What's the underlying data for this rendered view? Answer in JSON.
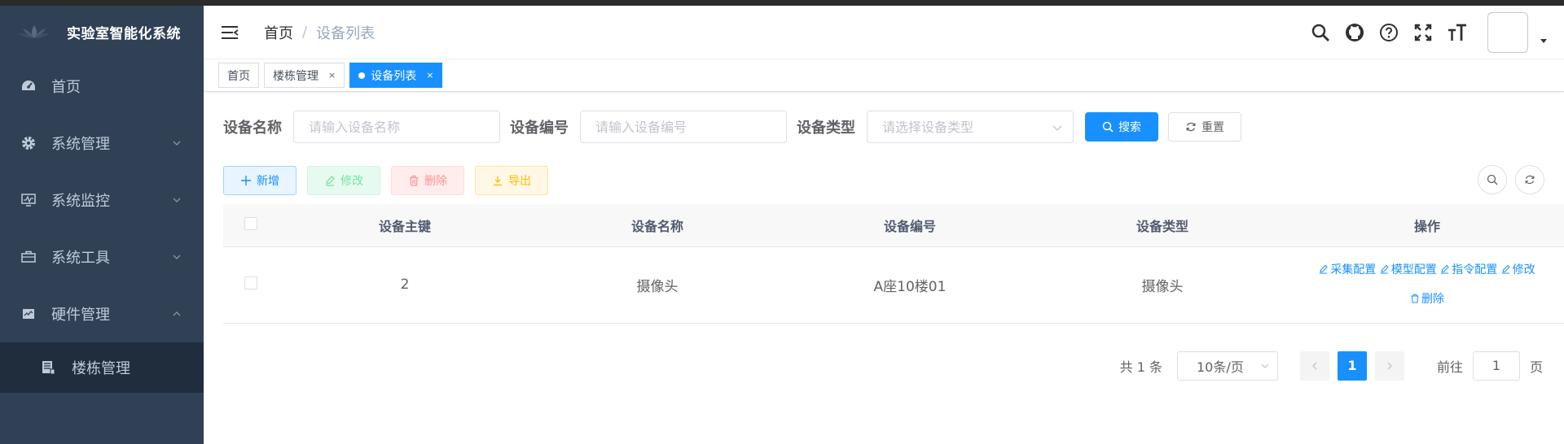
{
  "app": {
    "title": "实验室智能化系统"
  },
  "colors": {
    "primary": "#1890ff",
    "sidebar_bg": "#304156",
    "submenu_bg": "#1f2d3d"
  },
  "sidebar": {
    "items": [
      {
        "label": "首页",
        "icon": "dashboard-icon"
      },
      {
        "label": "系统管理",
        "icon": "gear-icon",
        "expandable": true
      },
      {
        "label": "系统监控",
        "icon": "monitor-icon",
        "expandable": true
      },
      {
        "label": "系统工具",
        "icon": "toolbox-icon",
        "expandable": true
      },
      {
        "label": "硬件管理",
        "icon": "hardware-icon",
        "expandable": true,
        "expanded": true
      }
    ],
    "subitems": [
      {
        "label": "楼栋管理",
        "icon": "building-icon"
      }
    ]
  },
  "header": {
    "breadcrumb": {
      "home": "首页",
      "separator": "/",
      "current": "设备列表"
    },
    "icons": [
      "search-icon",
      "github-icon",
      "help-icon",
      "fullscreen-icon",
      "font-size-icon"
    ]
  },
  "tags": [
    {
      "label": "首页",
      "active": false,
      "closable": false
    },
    {
      "label": "楼栋管理",
      "active": false,
      "closable": true
    },
    {
      "label": "设备列表",
      "active": true,
      "closable": true
    }
  ],
  "tag_close": "×",
  "search": {
    "name_label": "设备名称",
    "name_placeholder": "请输入设备名称",
    "code_label": "设备编号",
    "code_placeholder": "请输入设备编号",
    "type_label": "设备类型",
    "type_placeholder": "请选择设备类型",
    "search_btn": "搜索",
    "reset_btn": "重置"
  },
  "toolbar": {
    "add": "新增",
    "edit": "修改",
    "delete": "删除",
    "export": "导出"
  },
  "table": {
    "columns": [
      "设备主键",
      "设备名称",
      "设备编号",
      "设备类型",
      "操作"
    ],
    "rows": [
      {
        "id": "2",
        "name": "摄像头",
        "code": "A座10楼01",
        "type": "摄像头"
      }
    ],
    "ops": [
      "采集配置",
      "模型配置",
      "指令配置",
      "修改",
      "删除"
    ]
  },
  "pagination": {
    "total": "共 1 条",
    "page_size": "10条/页",
    "current_page": "1",
    "goto_prefix": "前往",
    "goto_value": "1",
    "goto_suffix": "页"
  }
}
